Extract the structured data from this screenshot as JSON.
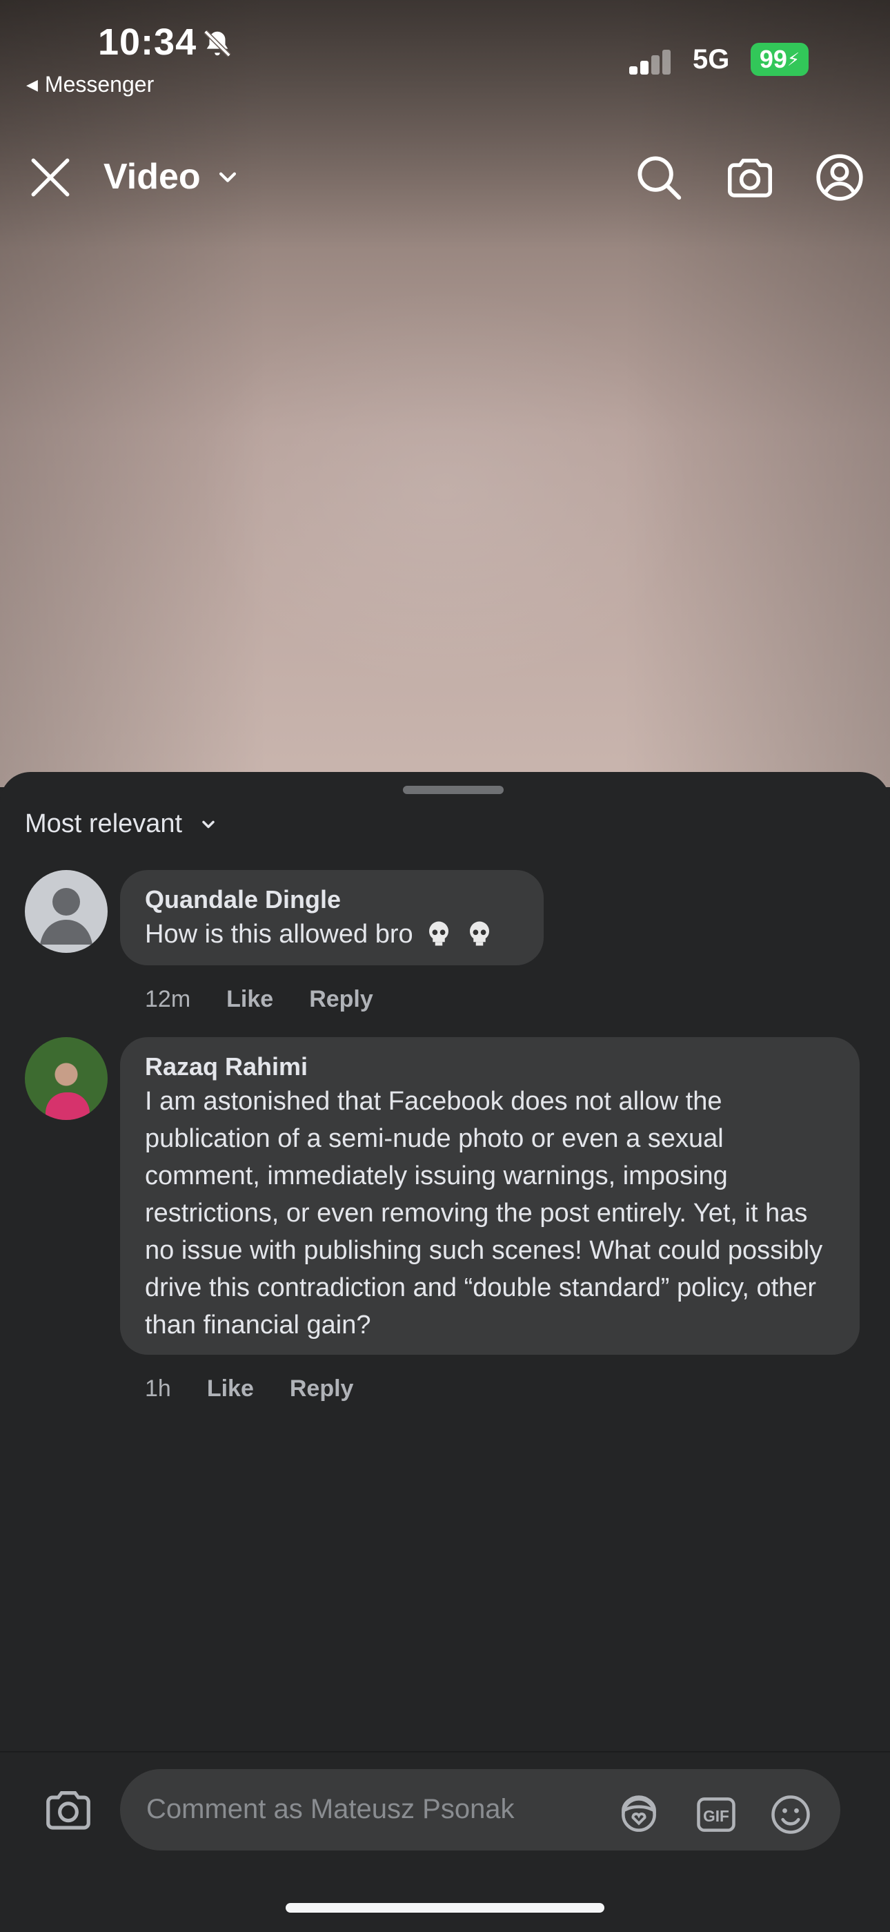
{
  "status_bar": {
    "time": "10:34",
    "back_app": "Messenger",
    "network": "5G",
    "battery": "99"
  },
  "header": {
    "title": "Video"
  },
  "comments": {
    "sort_label": "Most relevant",
    "items": [
      {
        "author": "Quandale Dingle",
        "text": "How is this allowed bro",
        "time": "12m",
        "like": "Like",
        "reply": "Reply"
      },
      {
        "author": "Razaq Rahimi",
        "text": "I am astonished that Facebook does not allow the publication of a semi-nude photo or even a sexual comment, immediately issuing warnings, imposing restrictions, or even removing the post entirely. Yet, it has no issue with publishing such scenes! What could possibly drive this contradiction and “double standard” policy, other than financial gain?",
        "time": "1h",
        "like": "Like",
        "reply": "Reply"
      }
    ]
  },
  "composer": {
    "placeholder": "Comment as Mateusz Psonak"
  },
  "colors": {
    "sheet_bg": "#242526",
    "bubble_bg": "#3a3b3c",
    "battery_green": "#32c759"
  }
}
